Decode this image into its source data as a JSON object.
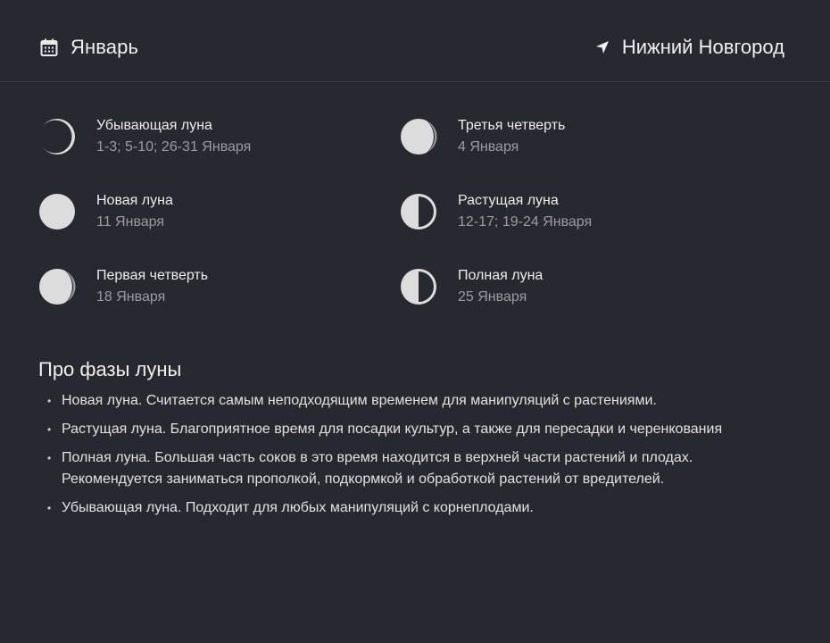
{
  "header": {
    "month": "Январь",
    "month_icon": "calendar-icon",
    "city": "Нижний Новгород",
    "city_icon": "location-arrow-icon"
  },
  "phases": [
    {
      "name": "Убывающая луна",
      "dates": "1-3; 5-10; 26-31 Января",
      "icon": "waning-moon-icon"
    },
    {
      "name": "Третья четверть",
      "dates": "4 Января",
      "icon": "third-quarter-moon-icon"
    },
    {
      "name": "Новая луна",
      "dates": "11 Января",
      "icon": "new-moon-icon"
    },
    {
      "name": "Растущая луна",
      "dates": "12-17; 19-24 Января",
      "icon": "waxing-moon-icon"
    },
    {
      "name": "Первая четверть",
      "dates": "18 Января",
      "icon": "first-quarter-moon-icon"
    },
    {
      "name": "Полная луна",
      "dates": "25 Января",
      "icon": "full-moon-icon"
    }
  ],
  "about": {
    "title": "Про фазы луны",
    "bullet": "•",
    "items": [
      "Новая луна. Считается самым неподходящим временем для манипуляций с растениями.",
      "Растущая луна. Благоприятное время для посадки культур, а также для пересадки и черенкования",
      "Полная луна. Большая часть соков в это время находится в верхней части растений и плодах. Рекомендуется заниматься прополкой, подкормкой и обработкой растений от вредителей.",
      "Убывающая луна. Подходит для любых манипуляций с корнеплодами."
    ]
  },
  "colors": {
    "background": "#26292f",
    "moon_light": "#dcdcdc",
    "text_secondary": "#9a9ca1"
  }
}
